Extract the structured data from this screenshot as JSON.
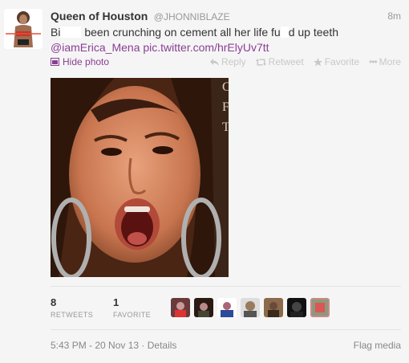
{
  "tweet": {
    "display_name": "Queen of Houston",
    "username": "@JHONNIBLAZE",
    "time_ago": "8m",
    "text_part1": "Bi",
    "text_part2": "been crunching on cement all her life fu",
    "text_part3": "d up teeth",
    "mention": "@iamErica_Mena",
    "pic_link": "pic.twitter.com/hrElyUv7tt"
  },
  "actions": {
    "hide_photo": "Hide photo",
    "reply": "Reply",
    "retweet": "Retweet",
    "favorite": "Favorite",
    "more": "More"
  },
  "photo_overlay": [
    "C",
    "F",
    "T"
  ],
  "stats": {
    "retweets_count": "8",
    "retweets_label": "RETWEETS",
    "favorites_count": "1",
    "favorites_label": "FAVORITE"
  },
  "footer": {
    "timestamp": "5:43 PM - 20 Nov 13",
    "details": "Details",
    "flag": "Flag media"
  },
  "colors": {
    "link": "#8a3e94",
    "muted": "#999999",
    "action": "#c8c8c8"
  }
}
